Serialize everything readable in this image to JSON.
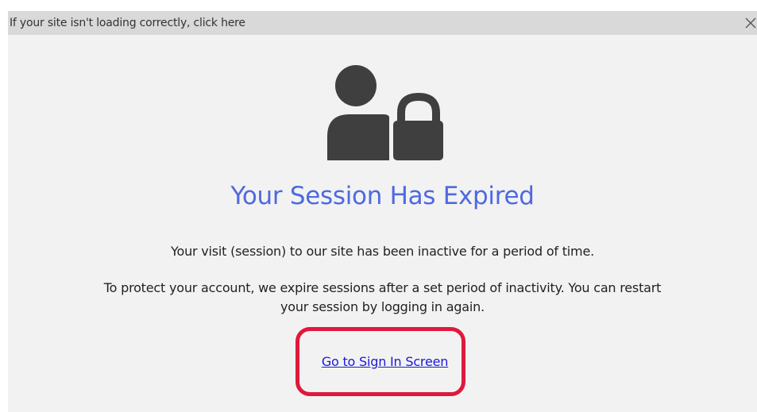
{
  "banner": {
    "message": "If your site isn't loading correctly, click here",
    "close_icon": "close-icon"
  },
  "main": {
    "icon": "user-lock-icon",
    "icon_color": "#3f3f3f",
    "title": "Your Session Has Expired",
    "title_color": "#4f69e0",
    "paragraph_1": "Your visit (session) to our site has been inactive for a period of time.",
    "paragraph_2_line_1": "To protect your account, we expire sessions after a set period of inactivity. You can restart",
    "paragraph_2_line_2": "your session by logging in again.",
    "signin_link": "Go to Sign In Screen",
    "highlight_color": "#e0183c"
  }
}
